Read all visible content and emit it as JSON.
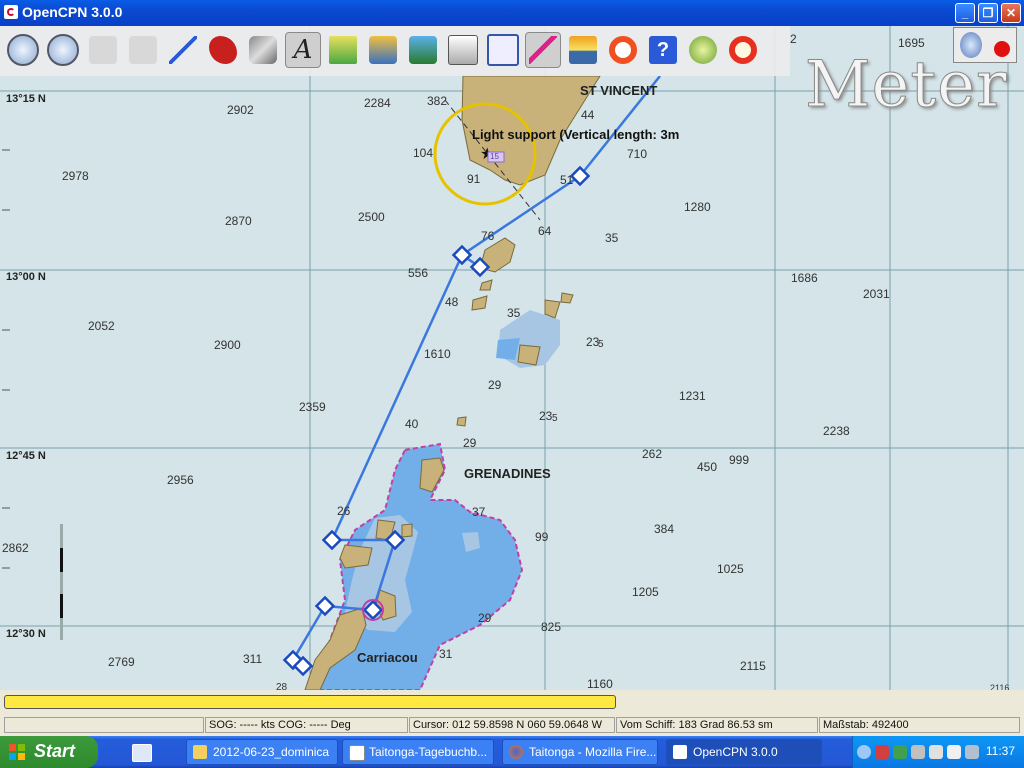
{
  "window": {
    "title": "OpenCPN 3.0.0"
  },
  "toolbar": {
    "buttons": [
      "zoom-in",
      "zoom-out",
      "scale-in",
      "scale-out",
      "route",
      "ship",
      "settings",
      "text",
      "tide",
      "current",
      "print",
      "route-manager",
      "track",
      "day-night",
      "mob",
      "help",
      "ais"
    ]
  },
  "scale_label": "Meter",
  "partial_top_right": "2",
  "chart": {
    "places": {
      "st_vincent": "ST VINCENT",
      "grenadines": "GRENADINES",
      "carriacou": "Carriacou"
    },
    "latitudes": {
      "lat_1315": "13°15 N",
      "lat_1300": "13°00 N",
      "lat_1245": "12°45 N",
      "lat_1230": "12°30 N"
    },
    "light_info": "Light support (Vertical length: 3m",
    "light_tag": "15",
    "depths": [
      "1695",
      "2902",
      "2284",
      "382",
      "44",
      "104",
      "710",
      "2978",
      "91",
      "51",
      "2870",
      "2500",
      "1280",
      "76",
      "64",
      "35",
      "556",
      "1686",
      "2031",
      "48",
      "2052",
      "35",
      "2900",
      "23",
      "5",
      "1610",
      "29",
      "2359",
      "40",
      "1231",
      "2238",
      "23",
      "5",
      "29",
      "2956",
      "262",
      "450",
      "999",
      "2862",
      "26",
      "37",
      "99",
      "384",
      "1025",
      "1205",
      "29",
      "825",
      "2769",
      "311",
      "31",
      "2115",
      "1160",
      "28",
      "2116"
    ]
  },
  "status": {
    "sog_cog": "SOG: ----- kts  COG: ----- Deg",
    "cursor": "Cursor: 012 59.8598 N 060 59.0648 W",
    "from_ship": "Vom Schiff: 183 Grad   86.53 sm",
    "scale": "Maßstab:   492400"
  },
  "taskbar": {
    "start": "Start",
    "tasks": [
      {
        "label": "2012-06-23_dominica"
      },
      {
        "label": "Taitonga-Tagebuchb..."
      },
      {
        "label": "Taitonga - Mozilla Fire..."
      },
      {
        "label": "OpenCPN 3.0.0"
      }
    ],
    "clock": "11:37"
  },
  "colors": {
    "land": "#c8b27a",
    "shallow": "#72aee8",
    "mid": "#a6c6e4",
    "route": "#3a78e0",
    "sea": "#d4e4e8"
  }
}
